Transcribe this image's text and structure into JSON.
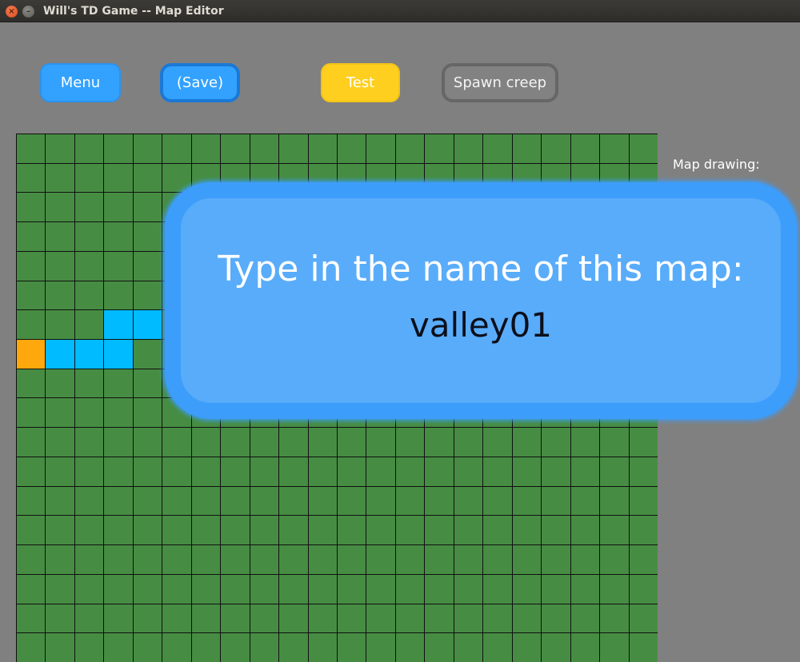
{
  "window": {
    "title": "Will's TD Game -- Map Editor",
    "close_glyph": "×",
    "minimize_glyph": "–"
  },
  "toolbar": {
    "menu_label": "Menu",
    "save_label": "(Save)",
    "test_label": "Test",
    "spawn_label": "Spawn creep"
  },
  "side_panel": {
    "label": "Map drawing:"
  },
  "map": {
    "columns": 22,
    "rows": 18,
    "tile_colors": {
      "grass": "#468d43",
      "path": "#00bbff",
      "spawn": "#ffa80d"
    },
    "path_tiles": [
      [
        3,
        6
      ],
      [
        4,
        6
      ],
      [
        1,
        7
      ],
      [
        2,
        7
      ],
      [
        3,
        7
      ]
    ],
    "spawn_tiles": [
      [
        0,
        7
      ]
    ]
  },
  "dialog": {
    "prompt": "Type in the name of this map:",
    "input_value": "valley01"
  }
}
